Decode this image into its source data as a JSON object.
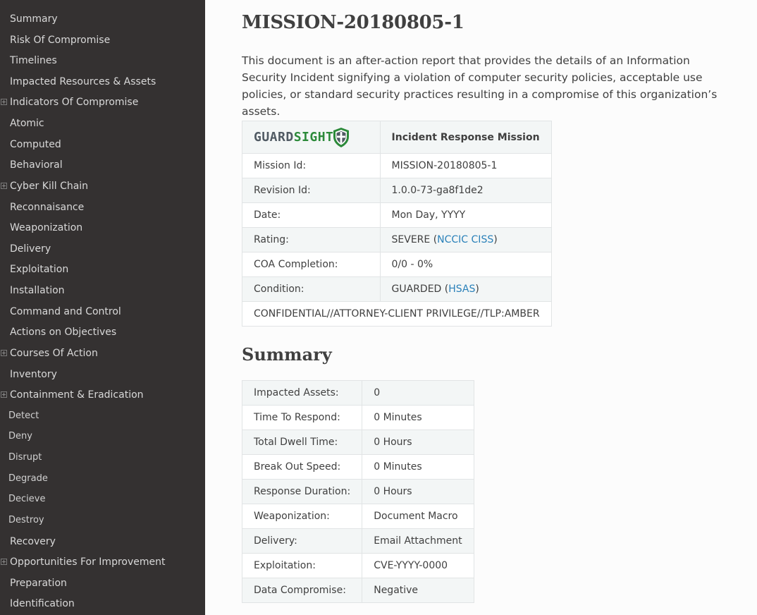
{
  "sidebar": {
    "items": [
      {
        "label": "Summary",
        "level": 1,
        "expandable": false
      },
      {
        "label": "Risk Of Compromise",
        "level": 1,
        "expandable": false
      },
      {
        "label": "Timelines",
        "level": 1,
        "expandable": false
      },
      {
        "label": "Impacted Resources & Assets",
        "level": 1,
        "expandable": false
      },
      {
        "label": "Indicators Of Compromise",
        "level": 1,
        "expandable": true
      },
      {
        "label": "Atomic",
        "level": 1,
        "expandable": false
      },
      {
        "label": "Computed",
        "level": 1,
        "expandable": false
      },
      {
        "label": "Behavioral",
        "level": 1,
        "expandable": false
      },
      {
        "label": "Cyber Kill Chain",
        "level": 1,
        "expandable": true
      },
      {
        "label": "Reconnaisance",
        "level": 1,
        "expandable": false
      },
      {
        "label": "Weaponization",
        "level": 1,
        "expandable": false
      },
      {
        "label": "Delivery",
        "level": 1,
        "expandable": false
      },
      {
        "label": "Exploitation",
        "level": 1,
        "expandable": false
      },
      {
        "label": "Installation",
        "level": 1,
        "expandable": false
      },
      {
        "label": "Command and Control",
        "level": 1,
        "expandable": false
      },
      {
        "label": "Actions on Objectives",
        "level": 1,
        "expandable": false
      },
      {
        "label": "Courses Of Action",
        "level": 1,
        "expandable": true
      },
      {
        "label": "Inventory",
        "level": 1,
        "expandable": false
      },
      {
        "label": "Containment & Eradication",
        "level": 1,
        "expandable": true
      },
      {
        "label": "Detect",
        "level": 2,
        "expandable": false
      },
      {
        "label": "Deny",
        "level": 2,
        "expandable": false
      },
      {
        "label": "Disrupt",
        "level": 2,
        "expandable": false
      },
      {
        "label": "Degrade",
        "level": 2,
        "expandable": false
      },
      {
        "label": "Decieve",
        "level": 2,
        "expandable": false
      },
      {
        "label": "Destroy",
        "level": 2,
        "expandable": false
      },
      {
        "label": "Recovery",
        "level": 1,
        "expandable": false
      },
      {
        "label": "Opportunities For Improvement",
        "level": 1,
        "expandable": true
      },
      {
        "label": "Preparation",
        "level": 1,
        "expandable": false
      },
      {
        "label": "Identification",
        "level": 1,
        "expandable": false
      }
    ]
  },
  "main": {
    "title": "MISSION-20180805-1",
    "intro": "This document is an after-action report that provides the details of an Information Security Incident signifying a violation of computer security policies, acceptable use policies, or standard security practices resulting in a compromise of this organization’s assets.",
    "mission_table": {
      "logo_text_1": "GUARD",
      "logo_text_2": "SIGHT",
      "header": "Incident Response Mission",
      "rows": [
        {
          "label": "Mission Id:",
          "value": "MISSION-20180805-1"
        },
        {
          "label": "Revision Id:",
          "value": "1.0.0-73-ga8f1de2"
        },
        {
          "label": "Date:",
          "value": "Mon Day, YYYY"
        },
        {
          "label": "Rating:",
          "value": "SEVERE (",
          "link": "NCCIC CISS",
          "suffix": ")"
        },
        {
          "label": "COA Completion:",
          "value": "0/0 - 0%"
        },
        {
          "label": "Condition:",
          "value": "GUARDED (",
          "link": "HSAS",
          "suffix": ")"
        }
      ],
      "footer": "CONFIDENTIAL//ATTORNEY-CLIENT PRIVILEGE//TLP:AMBER"
    },
    "summary_heading": "Summary",
    "summary_table": [
      {
        "label": "Impacted Assets:",
        "value": "0"
      },
      {
        "label": "Time To Respond:",
        "value": "0 Minutes"
      },
      {
        "label": "Total Dwell Time:",
        "value": "0 Hours"
      },
      {
        "label": "Break Out Speed:",
        "value": "0 Minutes"
      },
      {
        "label": "Response Duration:",
        "value": "0 Hours"
      },
      {
        "label": "Weaponization:",
        "value": "Document Macro"
      },
      {
        "label": "Delivery:",
        "value": "Email Attachment"
      },
      {
        "label": "Exploitation:",
        "value": "CVE-YYYY-0000"
      },
      {
        "label": "Data Compromise:",
        "value": "Negative"
      }
    ]
  },
  "colors": {
    "sidebar_bg": "#343131",
    "link": "#2980b9",
    "logo_green": "#2c8a3a",
    "logo_gray": "#505a63"
  }
}
